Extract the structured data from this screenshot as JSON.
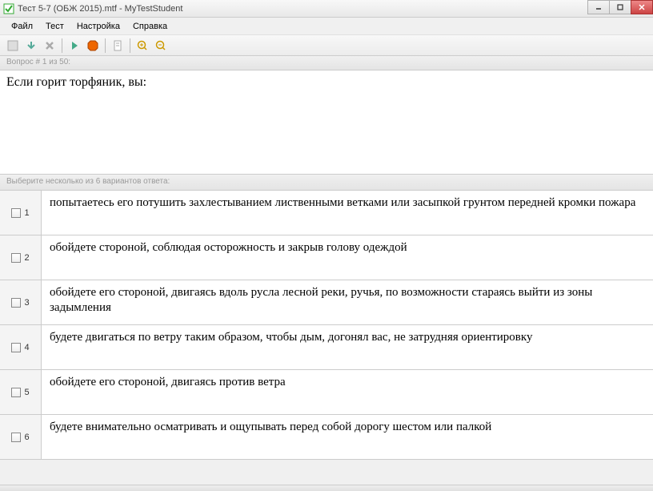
{
  "window": {
    "title": "Тест 5-7 (ОБЖ 2015).mtf - MyTestStudent"
  },
  "menu": {
    "file": "Файл",
    "test": "Тест",
    "settings": "Настройка",
    "help": "Справка"
  },
  "question_bar": "Вопрос # 1 из 50:",
  "question_text": "Если горит торфяник, вы:",
  "instruction": "Выберите несколько из 6 вариантов ответа:",
  "answers": [
    {
      "n": "1",
      "text": "попытаетесь его потушить захлестыванием лиственными ветками  или засыпкой грунтом передней кромки пожара"
    },
    {
      "n": "2",
      "text": "обойдете стороной, соблюдая осторожность и закрыв голову одеждой"
    },
    {
      "n": "3",
      "text": "обойдете его стороной, двигаясь вдоль русла лесной реки, ручья, по возможности стараясь выйти из зоны задымления"
    },
    {
      "n": "4",
      "text": "будете двигаться по ветру таким образом, чтобы дым, догонял вас, не затрудняя ориентировку"
    },
    {
      "n": "5",
      "text": "обойдете его стороной, двигаясь против ветра"
    },
    {
      "n": "6",
      "text": "будете внимательно осматривать и ощупывать перед собой дорогу шестом или палкой"
    }
  ]
}
